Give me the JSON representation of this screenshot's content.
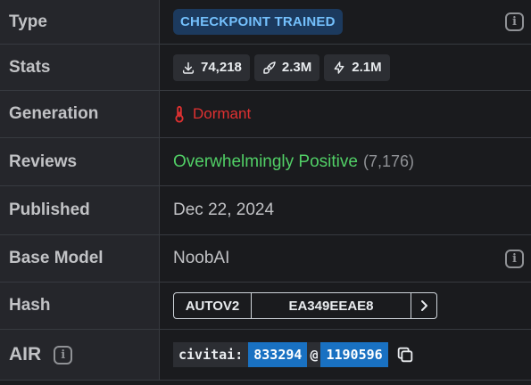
{
  "rows": {
    "type": {
      "label": "Type",
      "value": "CHECKPOINT TRAINED"
    },
    "stats": {
      "label": "Stats",
      "downloads": "74,218",
      "generations": "2.3M",
      "buzz": "2.1M"
    },
    "generation": {
      "label": "Generation",
      "value": "Dormant"
    },
    "reviews": {
      "label": "Reviews",
      "rating": "Overwhelmingly Positive",
      "count": "(7,176)"
    },
    "published": {
      "label": "Published",
      "value": "Dec 22, 2024"
    },
    "base_model": {
      "label": "Base Model",
      "value": "NoobAI"
    },
    "hash": {
      "label": "Hash",
      "type": "AUTOV2",
      "value": "EA349EEAE8"
    },
    "air": {
      "label": "AIR",
      "prefix": "civitai:",
      "model_id": "833294",
      "at": "@",
      "version_id": "1190596"
    }
  },
  "icons": {
    "info": "i",
    "download": "download-icon",
    "brush": "brush-icon",
    "bolt": "bolt-icon",
    "thermometer": "thermometer-icon",
    "chevron": "chevron-right-icon",
    "copy": "copy-icon"
  },
  "colors": {
    "accent_blue": "#1971c2",
    "badge_text": "#74c0fc",
    "positive": "#51cf66",
    "dormant": "#e03131"
  }
}
